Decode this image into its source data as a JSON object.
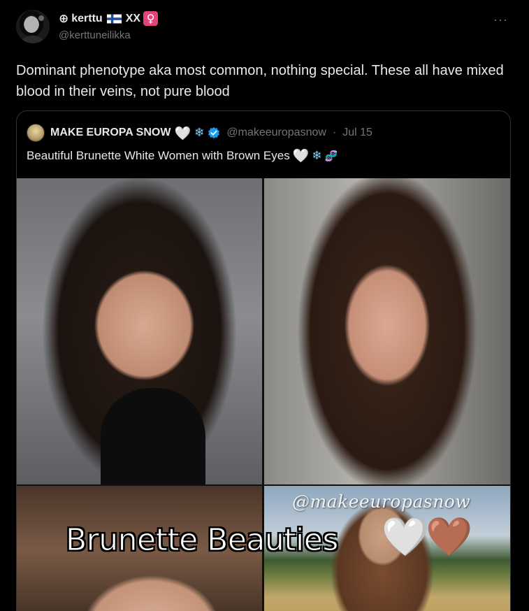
{
  "author": {
    "display_name": "kerttu",
    "name_prefix_symbol": "⊕",
    "flag": "FI",
    "name_suffix": "XX",
    "gender_symbol": "♀",
    "handle": "@kerttuneilikka",
    "avatar_icon": "avatar-dark-portrait"
  },
  "menu": {
    "more_label": "···"
  },
  "tweet": {
    "text": "Dominant phenotype aka most common, nothing special. These all have mixed blood in their veins, not pure blood"
  },
  "quote": {
    "display_name": "MAKE EUROPA SNOW",
    "name_emojis": [
      "🤍",
      "❄"
    ],
    "verified": true,
    "handle": "@makeeuropasnow",
    "separator": "·",
    "date": "Jul 15",
    "text": "Beautiful Brunette White Women with Brown Eyes",
    "text_emojis": [
      "🤍",
      "❄",
      "🧬"
    ],
    "media": {
      "watermark": "@makeeuropasnow",
      "overlay_title": "Brunette Beauties",
      "overlay_hearts": [
        "🤍",
        "🤎"
      ]
    }
  },
  "colors": {
    "background": "#000000",
    "text_primary": "#e7e9ea",
    "text_secondary": "#71767b",
    "border": "#2f3336",
    "verified_blue": "#1d9bf0"
  }
}
